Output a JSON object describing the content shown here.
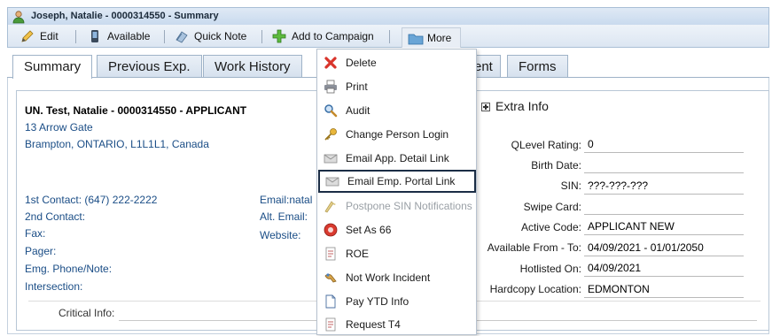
{
  "window": {
    "title": "Joseph, Natalie - 0000314550 - Summary"
  },
  "toolbar": {
    "edit": "Edit",
    "available": "Available",
    "quick_note": "Quick Note",
    "add_to_campaign": "Add to Campaign",
    "more": "More"
  },
  "tabs": [
    "Summary",
    "Previous Exp.",
    "Work History",
    "ent",
    "Forms"
  ],
  "contact": {
    "name_line": "UN. Test, Natalie - 0000314550 - APPLICANT",
    "address1": "13 Arrow Gate",
    "address2": "Brampton, ONTARIO, L1L1L1, Canada",
    "first_contact_label": "1st Contact:",
    "first_contact_value": "(647) 222-2222",
    "second_contact_label": "2nd Contact:",
    "fax_label": "Fax:",
    "pager_label": "Pager:",
    "emg_label": "Emg. Phone/Note:",
    "intersection_label": "Intersection:",
    "email_label": "Email:",
    "email_value": "natal",
    "alt_email_label": "Alt. Email:",
    "website_label": "Website:",
    "critical_info_label": "Critical Info:"
  },
  "extra_info": {
    "title": "Extra Info",
    "fields": [
      {
        "label": "QLevel Rating:",
        "value": "0"
      },
      {
        "label": "Birth Date:",
        "value": ""
      },
      {
        "label": "SIN:",
        "value": "???-???-???"
      },
      {
        "label": "Swipe Card:",
        "value": ""
      },
      {
        "label": "Active Code:",
        "value": "APPLICANT NEW"
      },
      {
        "label": "Available From - To:",
        "value": "04/09/2021 - 01/01/2050"
      },
      {
        "label": "Hotlisted On:",
        "value": "04/09/2021"
      },
      {
        "label": "Hardcopy Location:",
        "value": "EDMONTON"
      }
    ]
  },
  "more_menu": [
    {
      "label": "Delete",
      "icon": "delete-icon"
    },
    {
      "label": "Print",
      "icon": "printer-icon"
    },
    {
      "label": "Audit",
      "icon": "magnifier-icon"
    },
    {
      "label": "Change Person Login",
      "icon": "key-icon"
    },
    {
      "label": "Email App. Detail Link",
      "icon": "envelope-icon"
    },
    {
      "label": "Email Emp. Portal Link",
      "icon": "envelope-icon"
    },
    {
      "label": "Postpone SIN Notifications",
      "icon": "postpone-icon"
    },
    {
      "label": "Set As 66",
      "icon": "set66-icon"
    },
    {
      "label": "ROE",
      "icon": "document-icon"
    },
    {
      "label": "Not Work Incident",
      "icon": "incident-icon"
    },
    {
      "label": "Pay YTD Info",
      "icon": "page-icon"
    },
    {
      "label": "Request T4",
      "icon": "document-icon"
    }
  ],
  "colors": {
    "accent_blue": "#1a4d86",
    "highlight_border": "#1b2d45",
    "disabled": "#9aa0a6"
  }
}
